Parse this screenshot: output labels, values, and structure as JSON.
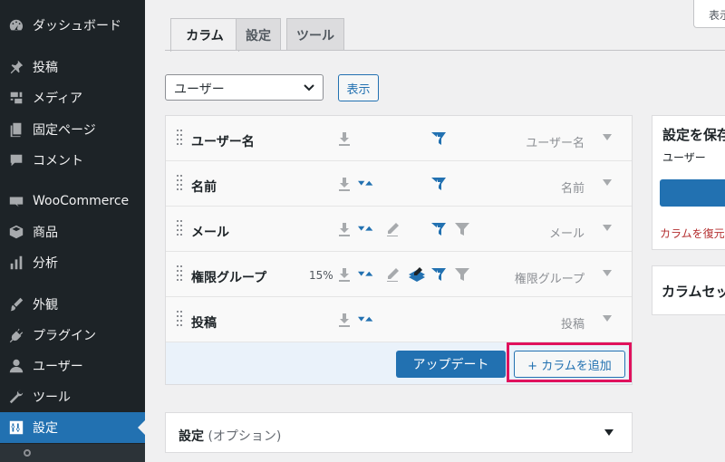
{
  "sidebar": {
    "items": [
      {
        "label": "ダッシュボード",
        "icon": "dashboard-icon"
      },
      {
        "label": "投稿",
        "icon": "pin-icon"
      },
      {
        "label": "メディア",
        "icon": "media-icon"
      },
      {
        "label": "固定ページ",
        "icon": "page-icon"
      },
      {
        "label": "コメント",
        "icon": "comment-icon"
      },
      {
        "label": "WooCommerce",
        "icon": "woocommerce-icon"
      },
      {
        "label": "商品",
        "icon": "product-box-icon"
      },
      {
        "label": "分析",
        "icon": "bar-chart-icon"
      },
      {
        "label": "外観",
        "icon": "paintbrush-icon"
      },
      {
        "label": "プラグイン",
        "icon": "plugin-icon"
      },
      {
        "label": "ユーザー",
        "icon": "user-icon"
      },
      {
        "label": "ツール",
        "icon": "wrench-icon"
      },
      {
        "label": "設定",
        "icon": "settings-sliders-icon",
        "active": true
      }
    ]
  },
  "header": {
    "screen_options_label": "表示"
  },
  "tabs": [
    {
      "label": "カラム",
      "active": true
    },
    {
      "label": "設定"
    },
    {
      "label": "ツール"
    }
  ],
  "filter": {
    "selected_screen": "ユーザー",
    "show_button": "表示"
  },
  "columns": [
    {
      "label": "ユーザー名",
      "type": "ユーザー名",
      "width": ""
    },
    {
      "label": "名前",
      "type": "名前",
      "width": ""
    },
    {
      "label": "メール",
      "type": "メール",
      "width": ""
    },
    {
      "label": "権限グループ",
      "type": "権限グループ",
      "width": "15%"
    },
    {
      "label": "投稿",
      "type": "投稿",
      "width": ""
    }
  ],
  "footer": {
    "update_button": "アップデート",
    "add_column_button": "+ カラムを追加"
  },
  "save_panel": {
    "title": "設定を保存",
    "subtitle": "ユーザー",
    "restore_link": "カラムを復元"
  },
  "column_sets_panel": {
    "title": "カラムセット"
  },
  "settings_panel": {
    "title": "設定",
    "subtitle": "(オプション)"
  },
  "colors": {
    "accent": "#2271b1",
    "sidebar_bg": "#1d2327",
    "highlight": "#e0125d",
    "danger": "#b32d2e"
  }
}
